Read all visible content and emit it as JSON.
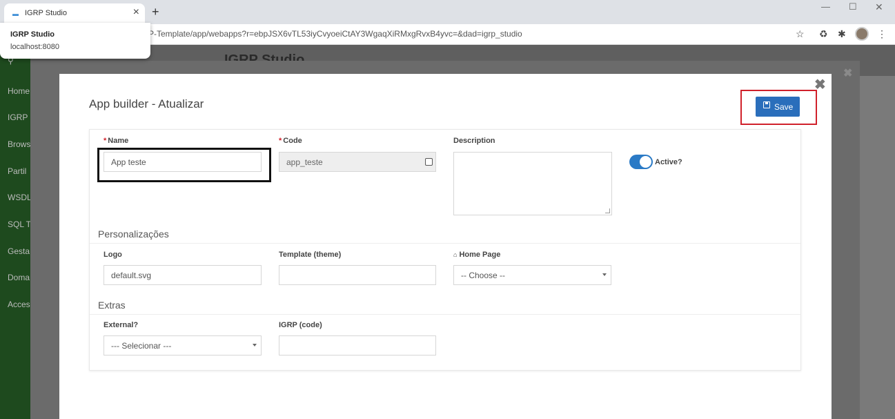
{
  "browser": {
    "tab_title": "IGRP Studio",
    "tab_favicon": "igrp-favicon-icon",
    "url": "P-Template/app/webapps?r=ebpJSX6vTL53iyCvyoeiCtAY3WgaqXiRMxgRvxB4yvc=&dad=igrp_studio",
    "popup_title": "IGRP Studio",
    "popup_url": "localhost:8080"
  },
  "background": {
    "header_title": "IGRP Studio",
    "sidebar_items": [
      "Home",
      "IGRP S",
      "Brows",
      "Partil",
      "WSDL",
      "SQL T",
      "Gesta",
      "Doma",
      "Acces"
    ]
  },
  "modal": {
    "title": "App builder - Atualizar",
    "save_label": "Save",
    "fields": {
      "name_label": "Name",
      "name_value": "App teste",
      "code_label": "Code",
      "code_value": "app_teste",
      "description_label": "Description",
      "active_label": "Active?",
      "active_checked": true
    },
    "personalizacoes": {
      "title": "Personalizações",
      "logo_label": "Logo",
      "logo_value": "default.svg",
      "template_label": "Template (theme)",
      "template_value": "",
      "homepage_label": "Home Page",
      "homepage_value": "-- Choose --"
    },
    "extras": {
      "title": "Extras",
      "external_label": "External?",
      "external_value": "--- Selecionar ---",
      "igrp_code_label": "IGRP (code)",
      "igrp_code_value": ""
    }
  },
  "colors": {
    "primary": "#2a6ebb",
    "required": "#d0202a",
    "sidebar": "#1e4a1e"
  }
}
